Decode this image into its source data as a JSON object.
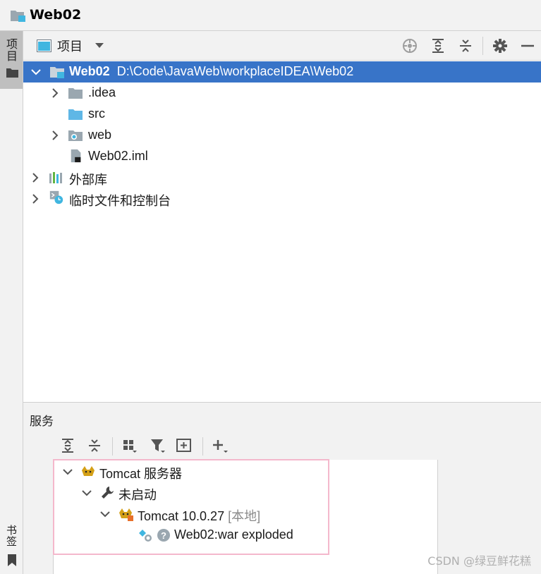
{
  "window": {
    "title": "Web02"
  },
  "left_strip": {
    "project_tab": "项目",
    "bookmarks_tab": "书签"
  },
  "project_panel": {
    "view_label": "项目",
    "tree": {
      "root": {
        "name": "Web02",
        "path": "D:\\Code\\JavaWeb\\workplaceIDEA\\Web02"
      },
      "children": [
        {
          "name": ".idea"
        },
        {
          "name": "src"
        },
        {
          "name": "web"
        },
        {
          "name": "Web02.iml"
        }
      ],
      "external_libs": "外部库",
      "scratches": "临时文件和控制台"
    }
  },
  "services_panel": {
    "title": "服务",
    "tree": {
      "server_group": "Tomcat 服务器",
      "status_group": "未启动",
      "server": {
        "name": "Tomcat 10.0.27",
        "qualifier": "[本地]"
      },
      "artifact": "Web02:war exploded"
    }
  },
  "colors": {
    "selection": "#3874c8",
    "highlight_border": "#f4b8cc"
  },
  "watermark": "CSDN @绿豆鲜花糕"
}
